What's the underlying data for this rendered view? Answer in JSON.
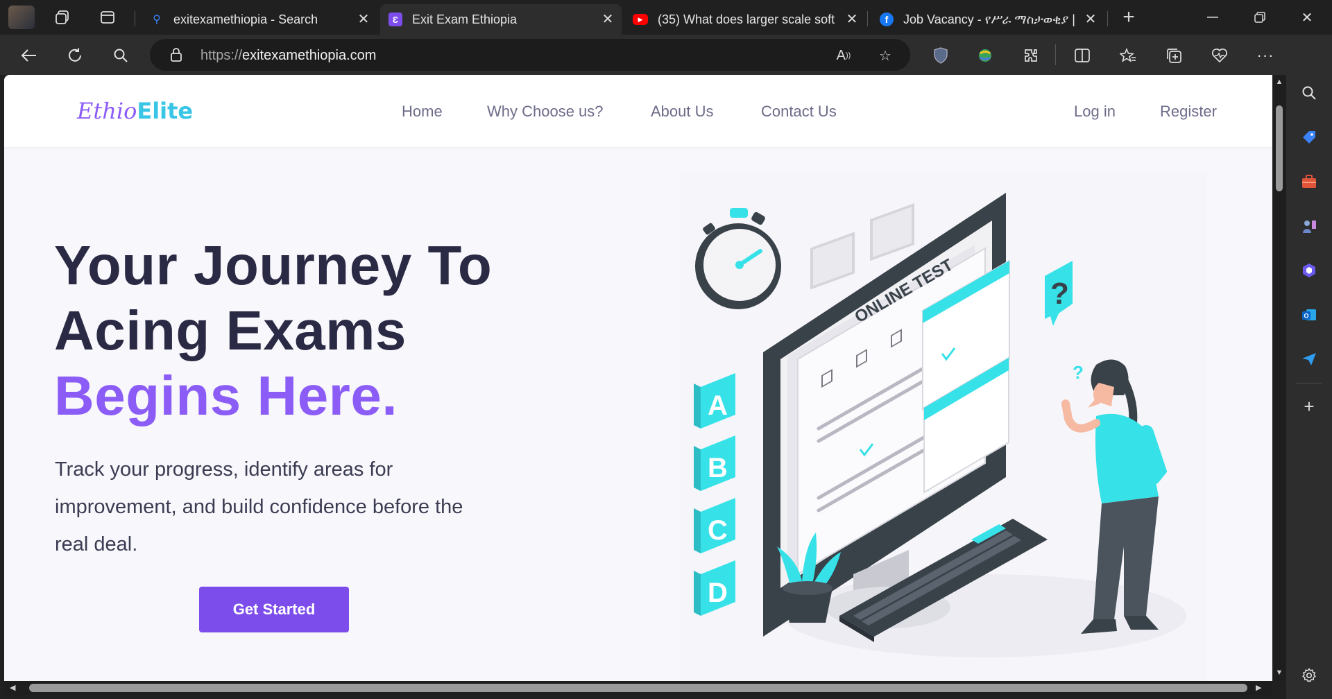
{
  "browser": {
    "tabs": [
      {
        "title": "exitexamethiopia - Search",
        "icon": "search-icon",
        "active": false
      },
      {
        "title": "Exit Exam Ethiopia",
        "icon": "site-favicon",
        "active": true
      },
      {
        "title": "(35) What does larger scale soft",
        "icon": "youtube-icon",
        "active": false
      },
      {
        "title": "Job Vacancy - የሥራ ማስታወቂያ |",
        "icon": "facebook-icon",
        "active": false
      }
    ],
    "new_tab_label": "+",
    "url_protocol": "https://",
    "url_host": "exitexamethiopia.com"
  },
  "site": {
    "logo_part1": "Ethio",
    "logo_part2": "Elite",
    "nav": {
      "home": "Home",
      "why": "Why Choose us?",
      "about": "About Us",
      "contact": "Contact Us",
      "login": "Log in",
      "register": "Register"
    },
    "hero": {
      "line1": "Your Journey To",
      "line2": "Acing Exams",
      "line3": "Begins Here.",
      "subtitle": "Track your progress, identify areas for improvement, and build confidence before the real deal.",
      "cta": "Get Started"
    },
    "illustration": {
      "test_label": "ONLINE TEST",
      "letters": [
        "A",
        "B",
        "C",
        "D"
      ],
      "option_letters": [
        "A",
        "B",
        "C",
        "D"
      ],
      "question_mark": "?"
    }
  },
  "colors": {
    "accent": "#8b5cf6",
    "button": "#7c4deb",
    "cyan": "#3ee3ea",
    "dark": "#2b2a44"
  }
}
